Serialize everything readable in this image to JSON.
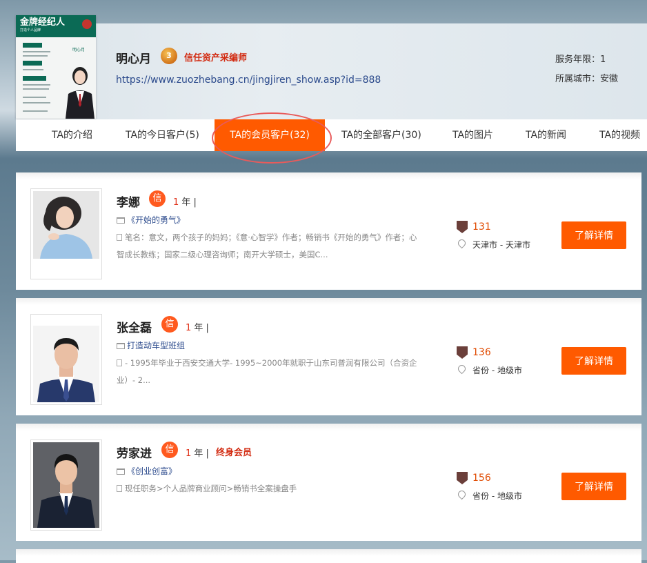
{
  "profile": {
    "name": "明心月",
    "medal_text": "3",
    "trust_title": "信任资产采编师",
    "url": "https://www.zuozhebang.cn/jingjiren_show.asp?id=888",
    "service_years": "服务年限：1",
    "city": "所属城市：安徽"
  },
  "poster": {
    "title": "金牌经纪人",
    "subtitle": "打造个人品牌",
    "name": "明心月"
  },
  "tabs": [
    {
      "label": "TA的介绍"
    },
    {
      "label": "TA的今日客户(5)"
    },
    {
      "label": "TA的会员客户(32)"
    },
    {
      "label": "TA的全部客户(30)"
    },
    {
      "label": "TA的图片"
    },
    {
      "label": "TA的新闻"
    },
    {
      "label": "TA的视频"
    }
  ],
  "members": [
    {
      "name": "李娜",
      "xin": "信",
      "years_num": "1",
      "years_suffix": " 年 |",
      "book": "《开始的勇气》",
      "desc": "笔名：意文，两个孩子的妈妈；《意·心智学》作者；畅销书《开始的勇气》作者；心智成长教练；国家二级心理咨询师；南开大学硕士，美国C...",
      "score": "131",
      "location": "天津市 - 天津市",
      "button": "了解详情"
    },
    {
      "name": "张全磊",
      "xin": "信",
      "years_num": "1",
      "years_suffix": " 年 |",
      "book": "打造动车型班组",
      "desc": "- 1995年毕业于西安交通大学- 1995~2000年就职于山东司普润有限公司（合资企业）- 2...",
      "score": "136",
      "location": "省份 - 地级市",
      "button": "了解详情"
    },
    {
      "name": "劳家进",
      "xin": "信",
      "years_num": "1",
      "years_suffix": " 年 |",
      "badge": "终身会员",
      "book": "《创业创富》",
      "desc": "现任职务>个人品牌商业顾问>畅销书全案操盘手",
      "score": "156",
      "location": "省份 - 地级市",
      "button": "了解详情"
    }
  ],
  "colors": {
    "accent": "#ff5a00",
    "title_red": "#d22a10",
    "link_blue": "#2b4a8c"
  }
}
